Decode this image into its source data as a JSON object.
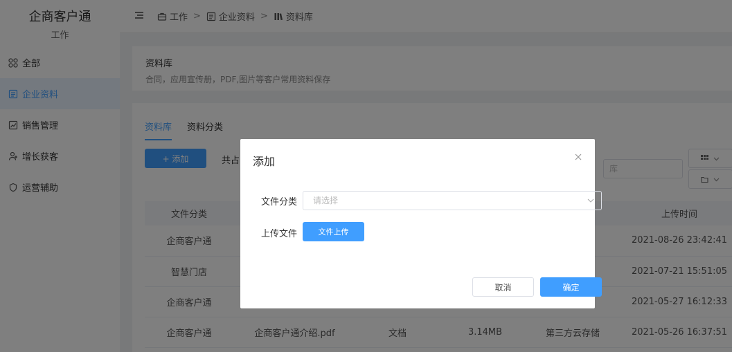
{
  "brand": {
    "name": "企商客户通",
    "subtitle": "工作"
  },
  "sidebar": {
    "items": [
      {
        "label": "全部",
        "icon": "grid-icon",
        "active": false
      },
      {
        "label": "企业资料",
        "icon": "document-icon",
        "active": true
      },
      {
        "label": "销售管理",
        "icon": "chart-icon",
        "active": false
      },
      {
        "label": "增长获客",
        "icon": "user-plus-icon",
        "active": false
      },
      {
        "label": "运营辅助",
        "icon": "shield-icon",
        "active": false
      }
    ]
  },
  "breadcrumb": [
    {
      "label": "工作",
      "icon": "briefcase-icon"
    },
    {
      "label": "企业资料",
      "icon": "document-icon"
    },
    {
      "label": "资料库",
      "icon": "library-icon"
    }
  ],
  "breadcrumb_separator": ">",
  "page": {
    "title": "资料库",
    "description": "合同，应用宣传册，PDF,图片等客户常用资料保存"
  },
  "tabs": [
    {
      "label": "资料库",
      "active": true
    },
    {
      "label": "资料分类",
      "active": false
    }
  ],
  "toolbar": {
    "add_label": "+ 添加",
    "total_text": "共占",
    "search_text": "库"
  },
  "table": {
    "headers": [
      "文件分类",
      "",
      "",
      "",
      "",
      "上传时间"
    ],
    "rows": [
      [
        "企商客户通",
        "",
        "",
        "",
        "",
        "2021-08-26 23:42:41"
      ],
      [
        "智慧门店",
        "",
        "",
        "",
        "",
        "2021-07-21 15:51:05"
      ],
      [
        "企商客户通",
        "",
        "",
        "",
        "",
        "2021-05-27 16:12:33"
      ],
      [
        "企商客户通",
        "企商客户通介绍.pdf",
        "文档",
        "3.14MB",
        "第三方云存储",
        "2021-05-26 16:37:51"
      ]
    ]
  },
  "dialog": {
    "title": "添加",
    "category_label": "文件分类",
    "category_placeholder": "请选择",
    "upload_label": "上传文件",
    "upload_button": "文件上传",
    "cancel_label": "取消",
    "confirm_label": "确定"
  },
  "colors": {
    "primary": "#409eff",
    "active_bg": "#e8f3ff",
    "overlay": "rgba(0,0,0,0.5)"
  }
}
